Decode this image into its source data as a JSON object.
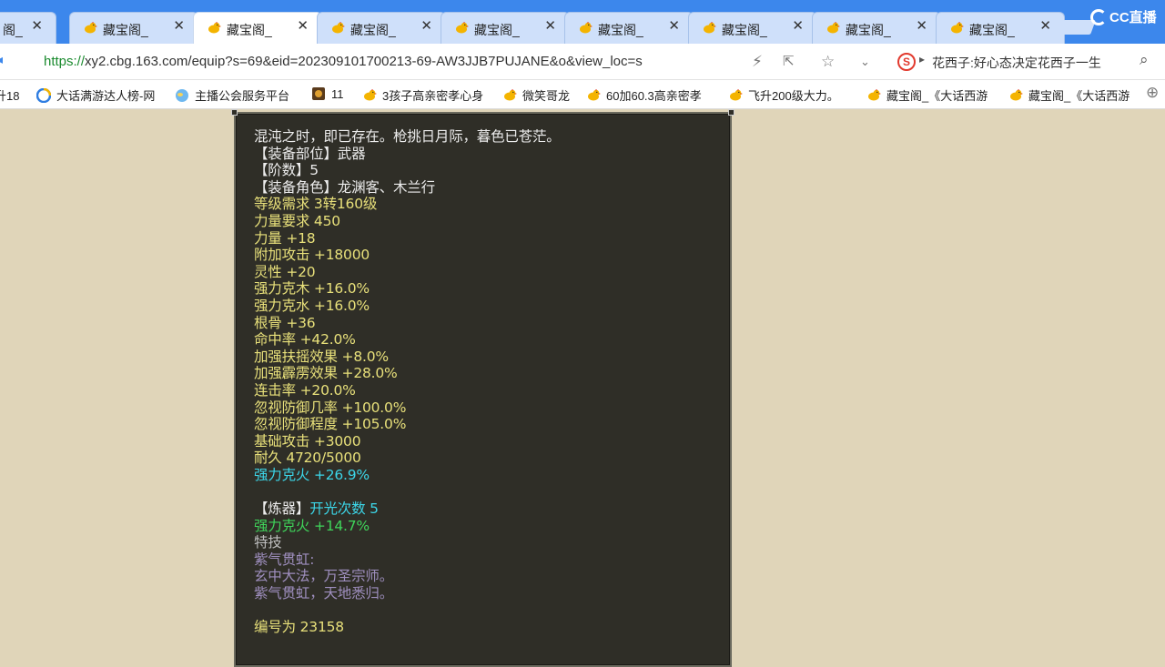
{
  "browser": {
    "tabs": [
      {
        "title": "藏宝阁_",
        "active": false
      },
      {
        "title": "藏宝阁_",
        "active": false
      },
      {
        "title": "藏宝阁_",
        "active": true
      },
      {
        "title": "藏宝阁_",
        "active": false
      },
      {
        "title": "藏宝阁_",
        "active": false
      },
      {
        "title": "藏宝阁_",
        "active": false
      },
      {
        "title": "藏宝阁_",
        "active": false
      },
      {
        "title": "藏宝阁_",
        "active": false
      },
      {
        "title": "藏宝阁_",
        "active": false
      }
    ],
    "first_tab_title": "阁_",
    "close_glyph": "✕",
    "logo_text": "CC直播",
    "url_scheme": "https://",
    "url_rest": "xy2.cbg.163.com/equip?s=69&eid=202309101700213-69-AW3JJB7PUJANE&o&view_loc=s",
    "search_text": "花西子:好心态决定花西子一生",
    "search_engine_glyph": "S",
    "bookmarks": [
      {
        "label": "升18",
        "icon": "none"
      },
      {
        "label": "大话满游达人榜-网",
        "icon": "browser-icon"
      },
      {
        "label": "主播公会服务平台",
        "icon": "globe-icon"
      },
      {
        "label": "11",
        "icon": "game-icon"
      },
      {
        "label": "3孩子高亲密孝心身",
        "icon": "chicken-icon"
      },
      {
        "label": "微笑哥龙",
        "icon": "chicken-icon"
      },
      {
        "label": "60加60.3高亲密孝",
        "icon": "chicken-icon"
      },
      {
        "label": "飞升200级大力。",
        "icon": "chicken-icon"
      },
      {
        "label": "藏宝阁_《大话西游",
        "icon": "chicken-icon"
      },
      {
        "label": "藏宝阁_《大话西游",
        "icon": "chicken-icon"
      }
    ]
  },
  "item": {
    "lines": [
      {
        "text": "混沌之时，即已存在。枪挑日月际，暮色已苍茫。",
        "color": "white"
      },
      {
        "text": "【装备部位】武器",
        "color": "white"
      },
      {
        "text": "【阶数】5",
        "color": "white"
      },
      {
        "text": "【装备角色】龙渊客、木兰行",
        "color": "white"
      },
      {
        "text": "等级需求 3转160级",
        "color": "yellow"
      },
      {
        "text": "力量要求 450",
        "color": "yellow"
      },
      {
        "text": "力量 +18",
        "color": "yellow"
      },
      {
        "text": "附加攻击 +18000",
        "color": "yellow"
      },
      {
        "text": "灵性 +20",
        "color": "yellow"
      },
      {
        "text": "强力克木 +16.0%",
        "color": "yellow"
      },
      {
        "text": "强力克水 +16.0%",
        "color": "yellow"
      },
      {
        "text": "根骨 +36",
        "color": "yellow"
      },
      {
        "text": "命中率 +42.0%",
        "color": "yellow"
      },
      {
        "text": "加强扶摇效果 +8.0%",
        "color": "yellow"
      },
      {
        "text": "加强霹雳效果 +28.0%",
        "color": "yellow"
      },
      {
        "text": "连击率 +20.0%",
        "color": "yellow"
      },
      {
        "text": "忽视防御几率 +100.0%",
        "color": "yellow"
      },
      {
        "text": "忽视防御程度 +105.0%",
        "color": "yellow"
      },
      {
        "text": "基础攻击 +3000",
        "color": "yellow"
      },
      {
        "text": "耐久 4720/5000",
        "color": "yellow"
      },
      {
        "text": "强力克火 +26.9%",
        "color": "cyan"
      },
      {
        "text": "",
        "color": "white"
      },
      {
        "text": "【炼器】",
        "color": "white",
        "suffix": "开光次数 5",
        "suffix_color": "cyan"
      },
      {
        "text": "强力克火 +14.7%",
        "color": "green"
      },
      {
        "text": "特技",
        "color": "gray"
      },
      {
        "text": "紫气贯虹:",
        "color": "purple"
      },
      {
        "text": "玄中大法，万圣宗师。",
        "color": "purple"
      },
      {
        "text": "紫气贯虹，天地悉归。",
        "color": "purple"
      },
      {
        "text": "",
        "color": "white"
      },
      {
        "text": "编号为 23158",
        "color": "yellow"
      }
    ]
  },
  "colors": {
    "tabbar": "#3c87ec",
    "page_bg": "#e0d5b9",
    "panel_bg": "#2f2e27"
  }
}
